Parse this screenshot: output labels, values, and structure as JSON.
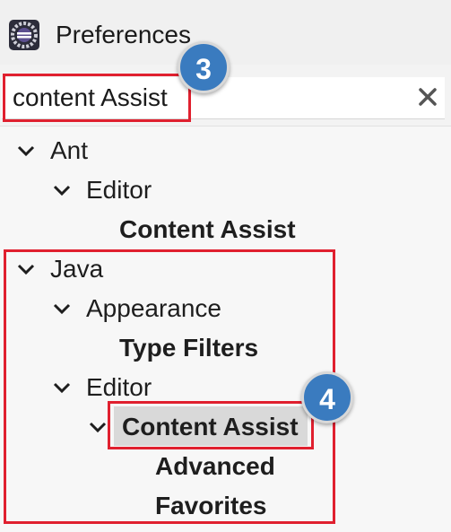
{
  "window": {
    "title": "Preferences",
    "icon": "eclipse-app-icon"
  },
  "search": {
    "value": "content Assist",
    "clear_icon": "clear-x-icon"
  },
  "tree": {
    "ant": {
      "label": "Ant",
      "editor": {
        "label": "Editor",
        "content_assist": "Content Assist"
      }
    },
    "java": {
      "label": "Java",
      "appearance": {
        "label": "Appearance",
        "type_filters": "Type Filters"
      },
      "editor": {
        "label": "Editor",
        "content_assist": {
          "label": "Content Assist",
          "selected": true,
          "advanced": "Advanced",
          "favorites": "Favorites"
        }
      }
    }
  },
  "annotations": {
    "step3": "3",
    "step4": "4",
    "highlight_color": "#e0202f",
    "badge_color": "#3a7bbf"
  }
}
